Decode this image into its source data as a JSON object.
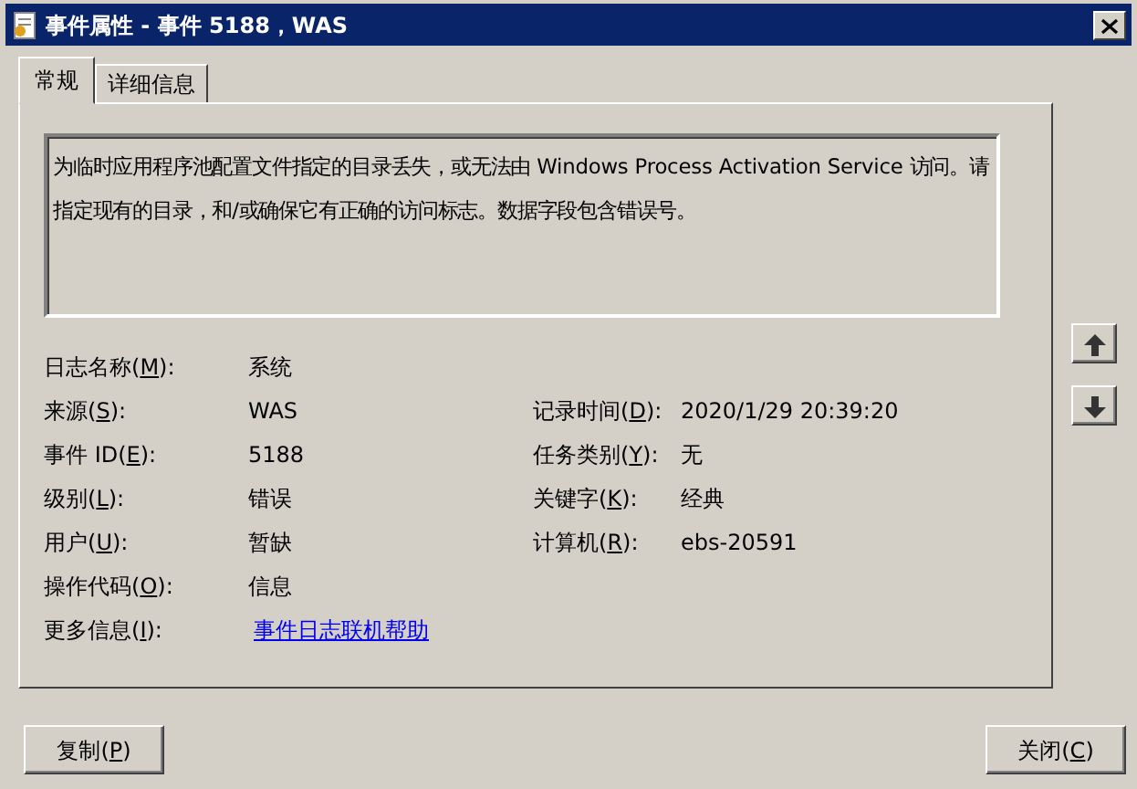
{
  "window": {
    "title": "事件属性 - 事件 5188，WAS"
  },
  "tabs": [
    {
      "label": "常规",
      "selected": true
    },
    {
      "label": "详细信息",
      "selected": false
    }
  ],
  "description": "为临时应用程序池配置文件指定的目录丢失，或无法由 Windows Process Activation Service 访问。请指定现有的目录，和/或确保它有正确的访问标志。数据字段包含错误号。",
  "fields": [
    {
      "left": {
        "label": [
          "日志名称(",
          "M",
          "):"
        ],
        "value": "系统",
        "kind": "text"
      }
    },
    {
      "left": {
        "label": [
          "来源(",
          "S",
          "):"
        ],
        "value": "WAS",
        "kind": "text"
      },
      "right": {
        "label": [
          "记录时间(",
          "D",
          "):"
        ],
        "value": "2020/1/29 20:39:20",
        "kind": "text"
      }
    },
    {
      "left": {
        "label": [
          "事件 ID(",
          "E",
          "):"
        ],
        "value": "5188",
        "kind": "text"
      },
      "right": {
        "label": [
          "任务类别(",
          "Y",
          "):"
        ],
        "value": "无",
        "kind": "text"
      }
    },
    {
      "left": {
        "label": [
          "级别(",
          "L",
          "):"
        ],
        "value": "错误",
        "kind": "text"
      },
      "right": {
        "label": [
          "关键字(",
          "K",
          "):"
        ],
        "value": "经典",
        "kind": "text"
      }
    },
    {
      "left": {
        "label": [
          "用户(",
          "U",
          "):"
        ],
        "value": "暂缺",
        "kind": "text"
      },
      "right": {
        "label": [
          "计算机(",
          "R",
          "):"
        ],
        "value": "ebs-20591",
        "kind": "text"
      }
    },
    {
      "left": {
        "label": [
          "操作代码(",
          "O",
          "):"
        ],
        "value": "信息",
        "kind": "text"
      }
    },
    {
      "left": {
        "label": [
          "更多信息(",
          "I",
          "):"
        ],
        "value": "事件日志联机帮助",
        "kind": "link"
      }
    }
  ],
  "buttons": [
    {
      "label": [
        "复制(",
        "P",
        ")"
      ]
    },
    {
      "label": [
        "关闭(",
        "C",
        ")"
      ]
    }
  ]
}
